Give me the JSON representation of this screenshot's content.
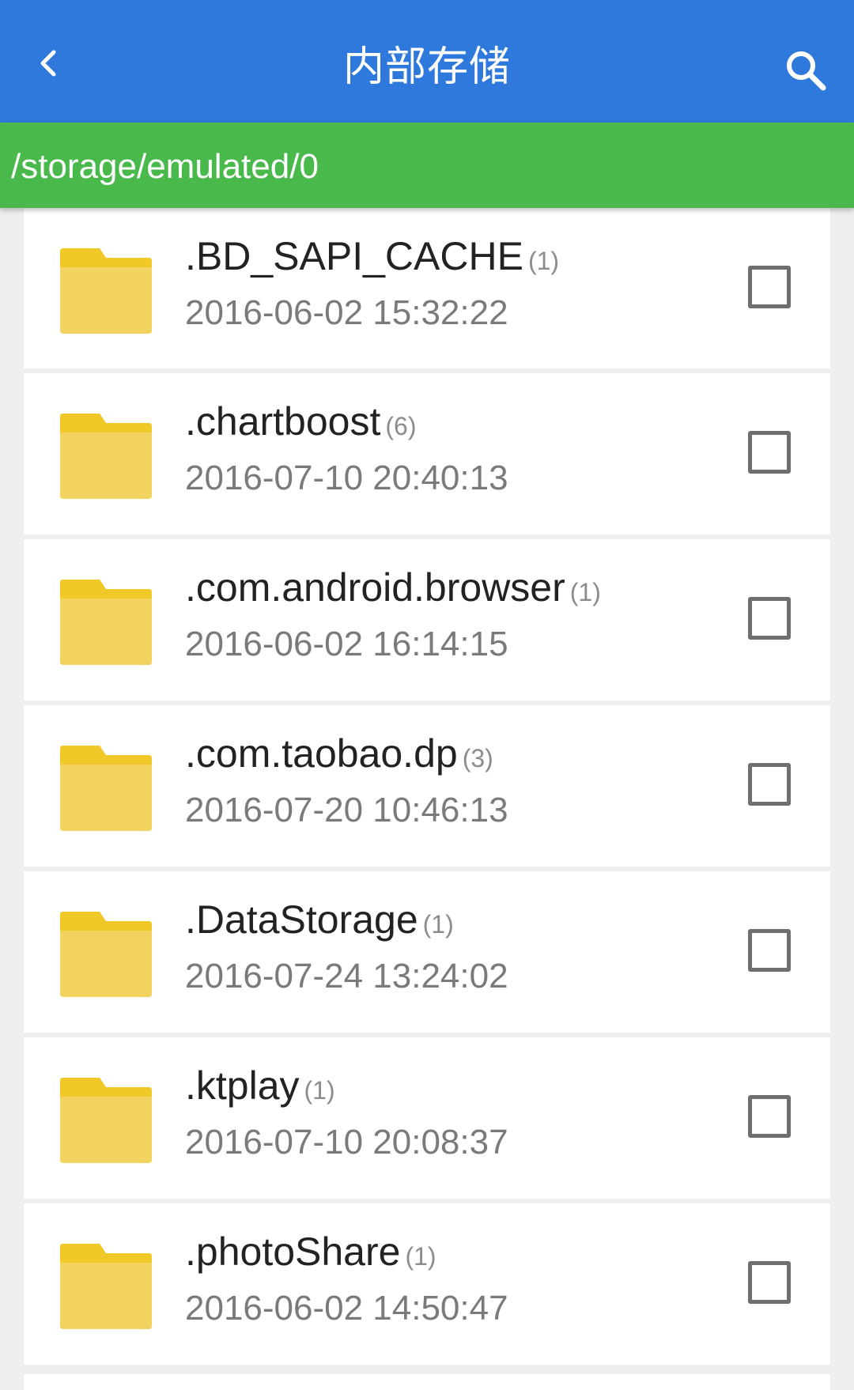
{
  "appbar": {
    "title": "内部存储",
    "back_icon": "chevron-left-icon",
    "search_icon": "search-icon",
    "color": "#2f78dc"
  },
  "pathbar": {
    "path": "/storage/emulated/0",
    "color": "#49b94c"
  },
  "files": [
    {
      "name": ".BD_SAPI_CACHE",
      "count": "(1)",
      "date": "2016-06-02 15:32:22",
      "checked": false,
      "icon": "folder-icon"
    },
    {
      "name": ".chartboost",
      "count": "(6)",
      "date": "2016-07-10 20:40:13",
      "checked": false,
      "icon": "folder-icon"
    },
    {
      "name": ".com.android.browser",
      "count": "(1)",
      "date": "2016-06-02 16:14:15",
      "checked": false,
      "icon": "folder-icon"
    },
    {
      "name": ".com.taobao.dp",
      "count": "(3)",
      "date": "2016-07-20 10:46:13",
      "checked": false,
      "icon": "folder-icon"
    },
    {
      "name": ".DataStorage",
      "count": "(1)",
      "date": "2016-07-24 13:24:02",
      "checked": false,
      "icon": "folder-icon"
    },
    {
      "name": ".ktplay",
      "count": "(1)",
      "date": "2016-07-10 20:08:37",
      "checked": false,
      "icon": "folder-icon"
    },
    {
      "name": ".photoShare",
      "count": "(1)",
      "date": "2016-06-02 14:50:47",
      "checked": false,
      "icon": "folder-icon"
    }
  ]
}
